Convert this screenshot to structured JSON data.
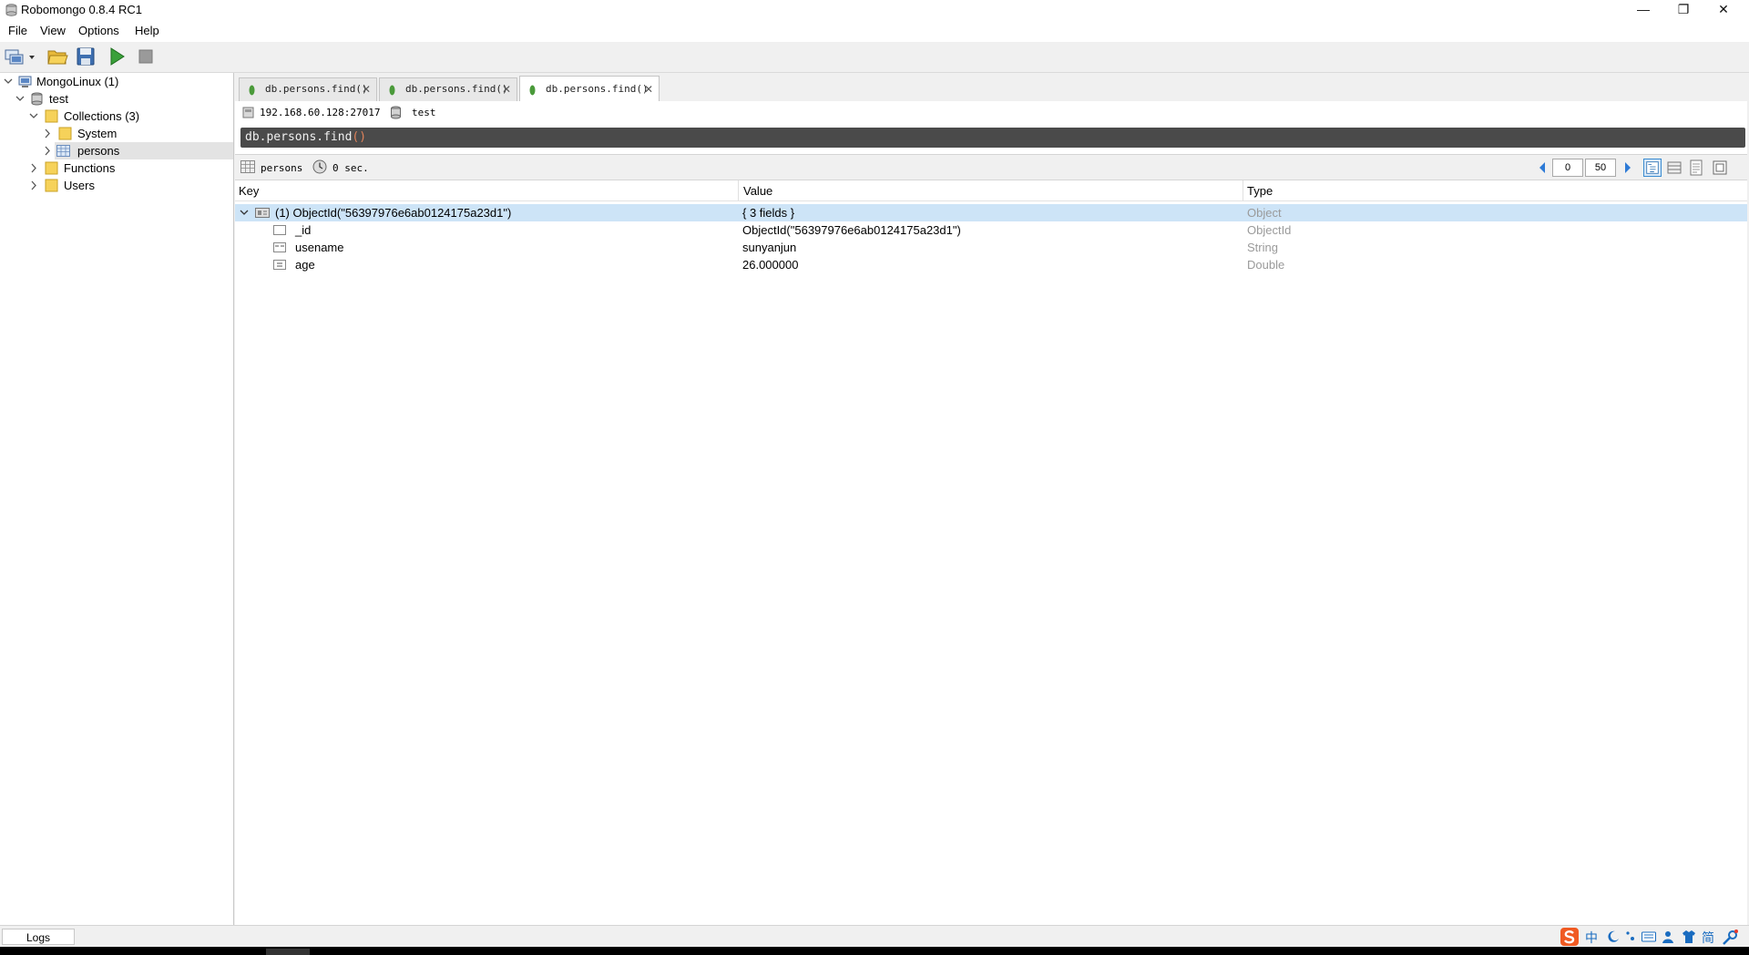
{
  "window": {
    "title": "Robomongo 0.8.4 RC1",
    "minimize_glyph": "—",
    "restore_glyph": "❐",
    "close_glyph": "✕"
  },
  "menu": {
    "items": [
      "File",
      "View",
      "Options",
      "Help"
    ]
  },
  "toolbar": {
    "icons": [
      "connect-icon",
      "dropdown-arrow-icon",
      "open-folder-icon",
      "save-icon",
      "execute-icon",
      "stop-icon"
    ]
  },
  "tree": {
    "connection": "MongoLinux (1)",
    "database": "test",
    "collections": "Collections (3)",
    "system": "System",
    "persons": "persons",
    "functions": "Functions",
    "users": "Users"
  },
  "tabs": [
    {
      "label": "db.persons.find()",
      "close": "✕"
    },
    {
      "label": "db.persons.find()",
      "close": "✕"
    },
    {
      "label": "db.persons.find()",
      "close": "✕"
    }
  ],
  "query": {
    "server": "192.168.60.128:27017",
    "database": "test",
    "code": "db.persons.find",
    "code_parens": "()"
  },
  "result": {
    "collection": "persons",
    "time": "0 sec.",
    "page_start": "0",
    "page_size": "50"
  },
  "grid": {
    "headers": {
      "key": "Key",
      "value": "Value",
      "type": "Type"
    },
    "rows": [
      {
        "key": "(1) ObjectId(\"56397976e6ab0124175a23d1\")",
        "value": "{ 3 fields }",
        "type": "Object"
      },
      {
        "key": "_id",
        "value": "ObjectId(\"56397976e6ab0124175a23d1\")",
        "type": "ObjectId"
      },
      {
        "key": "usename",
        "value": "sunyanjun",
        "type": "String"
      },
      {
        "key": "age",
        "value": "26.000000",
        "type": "Double"
      }
    ]
  },
  "status": {
    "logs": "Logs",
    "ime": [
      "中",
      "简"
    ]
  },
  "colors": {
    "selected_row": "#cde4f7",
    "editor_bg": "#4a4a4a",
    "execute_green": "#3aa03a",
    "folder_yellow": "#f6d25a"
  }
}
